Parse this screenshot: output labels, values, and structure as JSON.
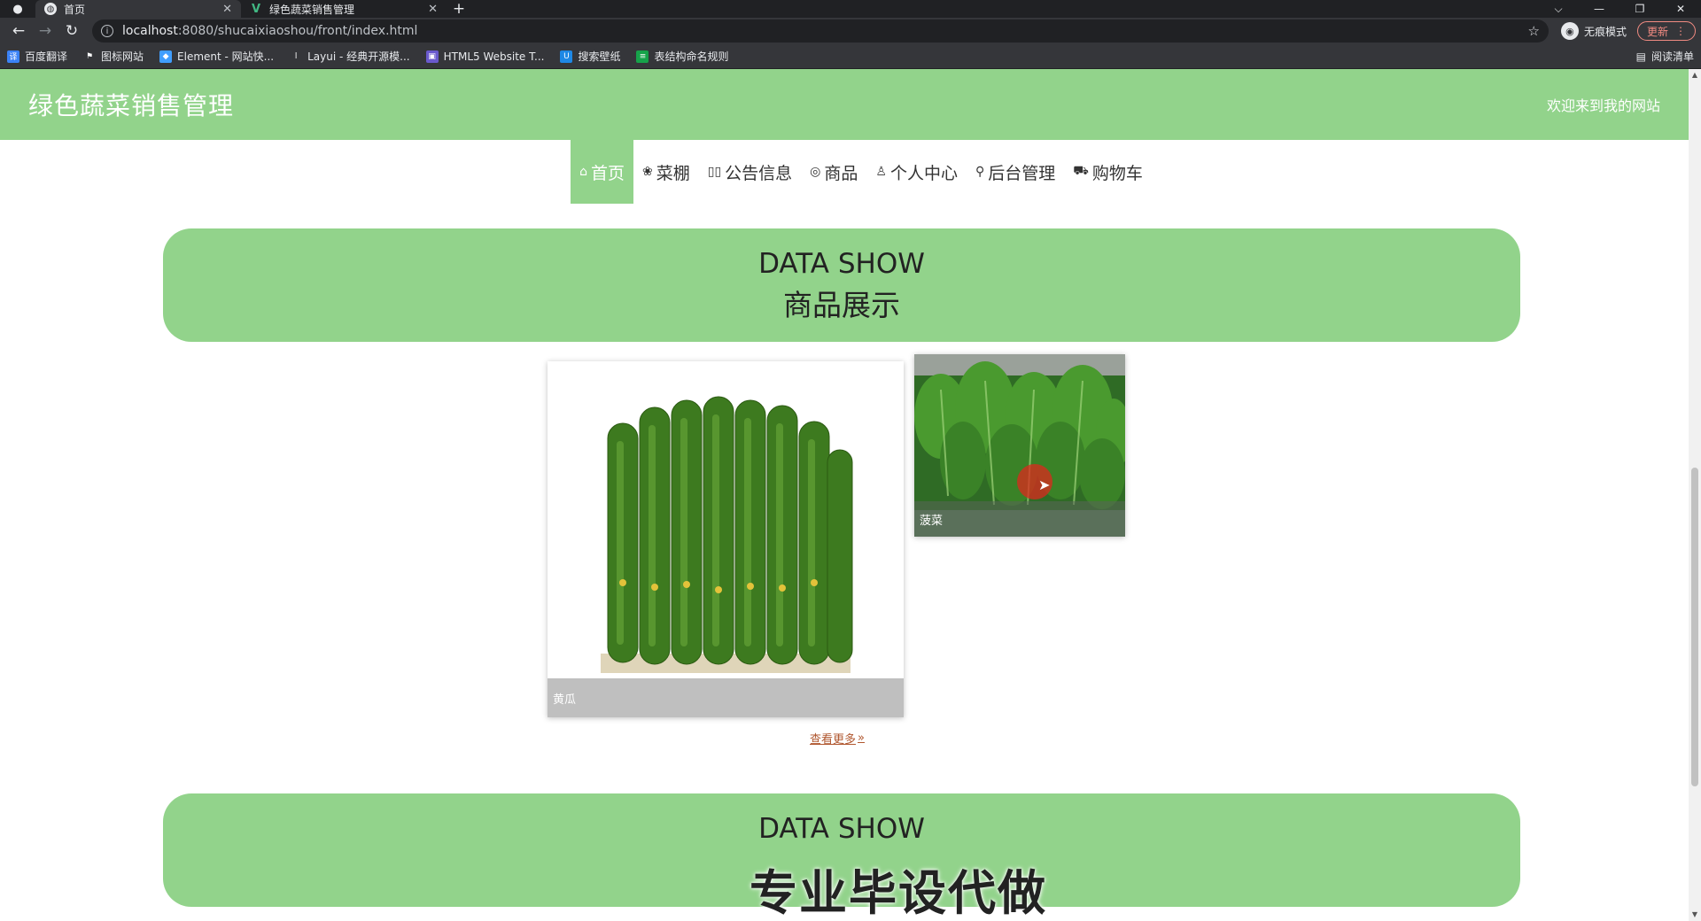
{
  "browser": {
    "tabs": [
      {
        "title": "首页",
        "active": true,
        "icon": "globe-icon"
      },
      {
        "title": "绿色蔬菜销售管理",
        "active": false,
        "icon": "vue-logo-icon"
      }
    ],
    "new_tab_glyph": "+",
    "url_host": "localhost",
    "url_rest": ":8080/shucaixiaoshou/front/index.html",
    "incognito_label": "无痕模式",
    "update_label": "更新",
    "bookmarks": [
      {
        "label": "百度翻译",
        "icon_color": "#3b82f6",
        "icon_text": "译"
      },
      {
        "label": "图标网站",
        "icon_color": "#5f6368",
        "icon_text": "⚑"
      },
      {
        "label": "Element - 网站快...",
        "icon_color": "#409eff",
        "icon_text": "◆"
      },
      {
        "label": "Layui - 经典开源模...",
        "icon_color": "#5f6368",
        "icon_text": "l"
      },
      {
        "label": "HTML5 Website T...",
        "icon_color": "#6a5acd",
        "icon_text": "▣"
      },
      {
        "label": "搜索壁纸",
        "icon_color": "#1e88e5",
        "icon_text": "U"
      },
      {
        "label": "表结构命名规则",
        "icon_color": "#16a34a",
        "icon_text": "≡"
      }
    ],
    "reading_list_label": "阅读清单"
  },
  "site": {
    "title": "绿色蔬菜销售管理",
    "welcome": "欢迎来到我的网站",
    "accent": "#92d38b"
  },
  "nav": {
    "items": [
      {
        "label": "首页",
        "icon": "home-icon",
        "glyph": "⌂",
        "active": true
      },
      {
        "label": "菜棚",
        "icon": "palette-icon",
        "glyph": "❀",
        "active": false
      },
      {
        "label": "公告信息",
        "icon": "columns-icon",
        "glyph": "▯▯",
        "active": false
      },
      {
        "label": "商品",
        "icon": "box-icon",
        "glyph": "◎",
        "active": false
      },
      {
        "label": "个人中心",
        "icon": "user-icon",
        "glyph": "♙",
        "active": false
      },
      {
        "label": "后台管理",
        "icon": "link-icon",
        "glyph": "⚲",
        "active": false
      },
      {
        "label": "购物车",
        "icon": "cart-icon",
        "glyph": "⛟",
        "active": false
      }
    ]
  },
  "banner1": {
    "en": "DATA SHOW",
    "zh": "商品展示"
  },
  "products": [
    {
      "name": "黄瓜",
      "image": "cucumbers"
    },
    {
      "name": "菠菜",
      "image": "spinach"
    }
  ],
  "more_link": "查看更多",
  "banner2": {
    "en": "DATA SHOW"
  },
  "watermark": "专业毕设代做"
}
